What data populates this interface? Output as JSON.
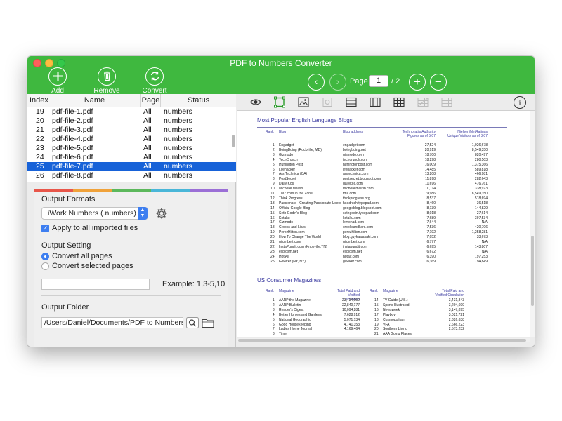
{
  "window": {
    "title": "PDF to Numbers Converter"
  },
  "toolbar": {
    "add_label": "Add",
    "remove_label": "Remove",
    "convert_label": "Convert",
    "page_label": "Page",
    "page_current": "1",
    "page_total": "/ 2",
    "prev_glyph": "‹",
    "next_glyph": "›",
    "zoom_in_glyph": "+",
    "zoom_out_glyph": "−"
  },
  "file_list": {
    "headers": {
      "index": "Index",
      "name": "Name",
      "page": "Page",
      "status": "Status"
    },
    "rows": [
      {
        "index": "19",
        "name": "pdf-file-1.pdf",
        "page": "All",
        "status": "numbers"
      },
      {
        "index": "20",
        "name": "pdf-file-2.pdf",
        "page": "All",
        "status": "numbers"
      },
      {
        "index": "21",
        "name": "pdf-file-3.pdf",
        "page": "All",
        "status": "numbers"
      },
      {
        "index": "22",
        "name": "pdf-file-4.pdf",
        "page": "All",
        "status": "numbers"
      },
      {
        "index": "23",
        "name": "pdf-file-5.pdf",
        "page": "All",
        "status": "numbers"
      },
      {
        "index": "24",
        "name": "pdf-file-6.pdf",
        "page": "All",
        "status": "numbers"
      },
      {
        "index": "25",
        "name": "pdf-file-7.pdf",
        "page": "All",
        "status": "numbers"
      },
      {
        "index": "26",
        "name": "pdf-file-8.pdf",
        "page": "All",
        "status": "numbers"
      }
    ],
    "selected_index": 6
  },
  "settings": {
    "output_formats_title": "Output Formats",
    "format_value": "iWork Numbers (.numbers)",
    "apply_all_label": "Apply to all imported files",
    "output_setting_title": "Output Setting",
    "convert_all_label": "Convert all pages",
    "convert_selected_label": "Convert selected pages",
    "page_range_value": "",
    "example_label": "Example: 1,3-5,10",
    "output_folder_title": "Output Folder",
    "folder_path": "/Users/Daniel/Documents/PDF to Numbers Converter"
  },
  "preview": {
    "info_glyph": "i",
    "section1_title": "Most Popular English Language Blogs",
    "s1_headers": {
      "rank": "Rank",
      "blog": "Blog",
      "address": "Blog address",
      "authority": "Technorati's Authority\nFigures as of 5.07",
      "visitors": "Nielsen/NetRatings\nUnique Visitors as of 3.07"
    },
    "s1_rows": [
      [
        "1.",
        "Engadget",
        "engadget.com",
        "27,524",
        "1,026,678"
      ],
      [
        "2.",
        "BoingBoing (Rockville, MD)",
        "boingboing.net",
        "20,919",
        "8,549,350"
      ],
      [
        "3.",
        "Gizmodo",
        "gizmodo.com",
        "18,700",
        "820,497"
      ],
      [
        "4.",
        "TechCrunch",
        "techcrunch.com",
        "18,298",
        "280,503"
      ],
      [
        "5.",
        "Huffington Post",
        "huffingtonpost.com",
        "16,009",
        "1,375,366"
      ],
      [
        "6.",
        "Lifehacker",
        "lifehacker.com",
        "14,485",
        "589,818"
      ],
      [
        "7.",
        "Ars Technica (CA)",
        "arstechnica.com",
        "13,208",
        "466,981"
      ],
      [
        "8.",
        "PostSecret",
        "postsecret.blogspot.com",
        "11,898",
        "282,643"
      ],
      [
        "9.",
        "Daily Kos",
        "dailykos.com",
        "11,696",
        "476,761"
      ],
      [
        "10.",
        "Michelle Malkin",
        "michellemalkin.com",
        "10,114",
        "338,973"
      ],
      [
        "11.",
        "TMZ.com In the Zone",
        "tmz.com",
        "9,986",
        "8,549,350"
      ],
      [
        "12.",
        "Think Progress",
        "thinkprogress.org",
        "8,537",
        "518,694"
      ],
      [
        "13.",
        "Passionate - Creating Passionate Users",
        "headrush.typepad.com",
        "8,460",
        "36,518"
      ],
      [
        "14.",
        "Official Google Blog",
        "googleblog.blogspot.com",
        "8,139",
        "144,829"
      ],
      [
        "15.",
        "Seth Godin's Blog",
        "sethgodin.typepad.com",
        "8,018",
        "27,614"
      ],
      [
        "16.",
        "Kotaku",
        "kotaku.com",
        "7,689",
        "397,534"
      ],
      [
        "17.",
        "Gizmodo",
        "lemonad.com",
        "7,644",
        "N/A"
      ],
      [
        "18.",
        "Crooks and Liars",
        "crooksandliars.com",
        "7,536",
        "420,706"
      ],
      [
        "19.",
        "PerezHilton.com",
        "perezhilton.com",
        "7,192",
        "1,258,281"
      ],
      [
        "20.",
        "How To Change The World",
        "blog.guykawasaki.com",
        "7,052",
        "33,673"
      ],
      [
        "21.",
        "gilumbert.com",
        "gilumbert.com",
        "6,777",
        "N/A"
      ],
      [
        "22.",
        "InstaPundit.com (Knoxville,TN)",
        "instapundit.com",
        "6,695",
        "143,807"
      ],
      [
        "23.",
        "explosm.net",
        "explosm.net",
        "6,672",
        "N/A"
      ],
      [
        "24.",
        "Hot Air",
        "hotair.com",
        "6,390",
        "197,253"
      ],
      [
        "25.",
        "Gawker (NY, NY)",
        "gawker.com",
        "6,369",
        "794,849"
      ]
    ],
    "section2_title": "US Consumer Magazines",
    "s2_headers": {
      "rank": "Rank",
      "magazine": "Magazine",
      "circulation": "Total Paid and\nVerified Circulation"
    },
    "s2_rows": [
      [
        "1.",
        "AARP the Magazine",
        "23,434,052",
        "14.",
        "TV Guide (U.S.)",
        "3,431,843"
      ],
      [
        "2.",
        "AARP Bulletin",
        "22,840,177",
        "15.",
        "Sports Illustrated",
        "3,204,699"
      ],
      [
        "3.",
        "Reader's Digest",
        "10,094,281",
        "16.",
        "Newsweek",
        "3,147,895"
      ],
      [
        "4.",
        "Better Homes and Gardens",
        "7,628,912",
        "17.",
        "Playboy",
        "3,021,721"
      ],
      [
        "5.",
        "National Geographic",
        "5,071,134",
        "18.",
        "Cosmopolitan",
        "2,826,638"
      ],
      [
        "6.",
        "Good Housekeeping",
        "4,741,353",
        "19.",
        "VFA",
        "2,666,223"
      ],
      [
        "7.",
        "Ladies Home Journal",
        "4,169,464",
        "20.",
        "Southern Living",
        "2,573,232"
      ],
      [
        "8.",
        "Time",
        "",
        "21.",
        "AAA Going Places",
        ""
      ]
    ]
  },
  "colors": {
    "titlebar": "#3fb83f",
    "selection": "#1762d8",
    "accent": "#3d7ef0",
    "rainbow": [
      "#e8564a",
      "#f0a23a",
      "#5cb85c",
      "#49b6d8",
      "#9b6fd6"
    ]
  }
}
